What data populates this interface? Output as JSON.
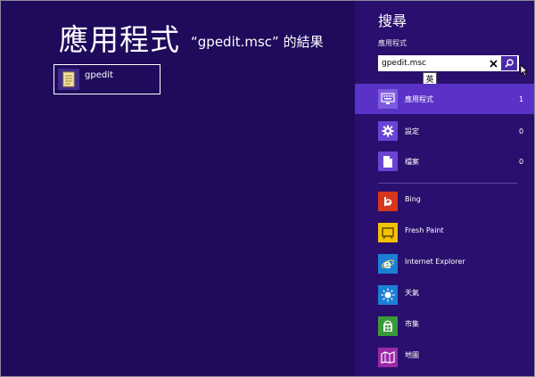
{
  "results": {
    "title": "應用程式",
    "subtitle": "“gpedit.msc” 的結果",
    "items": [
      {
        "label": "gpedit",
        "icon": "document-icon"
      }
    ]
  },
  "search_pane": {
    "title": "搜尋",
    "scope_label": "應用程式",
    "search": {
      "value": "gpedit.msc",
      "placeholder": ""
    },
    "ime_indicator": "英",
    "categories": [
      {
        "label": "應用程式",
        "count": "1",
        "icon": "keyboard-icon",
        "selected": true
      },
      {
        "label": "設定",
        "count": "0",
        "icon": "gear-icon",
        "selected": false
      },
      {
        "label": "檔案",
        "count": "0",
        "icon": "file-icon",
        "selected": false
      }
    ],
    "apps": [
      {
        "label": "Bing",
        "icon": "bing-icon",
        "color": "#d6361a"
      },
      {
        "label": "Fresh Paint",
        "icon": "fresh-paint-icon",
        "color": "#f2c200"
      },
      {
        "label": "Internet Explorer",
        "icon": "internet-explorer-icon",
        "color": "#1c7fd6"
      },
      {
        "label": "天氣",
        "icon": "weather-icon",
        "color": "#1c7fd6"
      },
      {
        "label": "市集",
        "icon": "store-icon",
        "color": "#3a9a3a"
      },
      {
        "label": "地圖",
        "icon": "maps-icon",
        "color": "#9a2aa6"
      }
    ]
  },
  "colors": {
    "background": "#1f0a5c",
    "pane": "#2a0f6e",
    "selected": "#5a32c8"
  }
}
